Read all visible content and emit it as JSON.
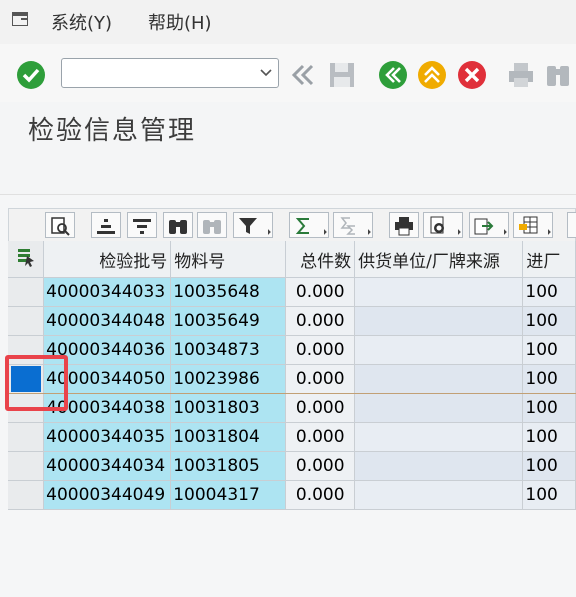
{
  "menu": {
    "system": "系统(Y)",
    "help": "帮助(H)"
  },
  "toolbar": {
    "command_value": ""
  },
  "page": {
    "title": "检验信息管理"
  },
  "table": {
    "headers": [
      "检验批号",
      "物料号",
      "总件数",
      "供货单位/厂牌来源",
      "进厂"
    ],
    "rows": [
      {
        "batch": "40000344033",
        "material": "10035648",
        "qty": "0.000",
        "supplier": "",
        "entry": "100"
      },
      {
        "batch": "40000344048",
        "material": "10035649",
        "qty": "0.000",
        "supplier": "",
        "entry": "100"
      },
      {
        "batch": "40000344036",
        "material": "10034873",
        "qty": "0.000",
        "supplier": "",
        "entry": "100"
      },
      {
        "batch": "40000344050",
        "material": "10023986",
        "qty": "0.000",
        "supplier": "",
        "entry": "100"
      },
      {
        "batch": "40000344038",
        "material": "10031803",
        "qty": "0.000",
        "supplier": "",
        "entry": "100"
      },
      {
        "batch": "40000344035",
        "material": "10031804",
        "qty": "0.000",
        "supplier": "",
        "entry": "100"
      },
      {
        "batch": "40000344034",
        "material": "10031805",
        "qty": "0.000",
        "supplier": "",
        "entry": "100"
      },
      {
        "batch": "40000344049",
        "material": "10004317",
        "qty": "0.000",
        "supplier": "",
        "entry": "100"
      }
    ]
  },
  "colors": {
    "selected": "#0a6ed1",
    "key_cell": "#ade4f2",
    "highlight": "#e9434b"
  }
}
